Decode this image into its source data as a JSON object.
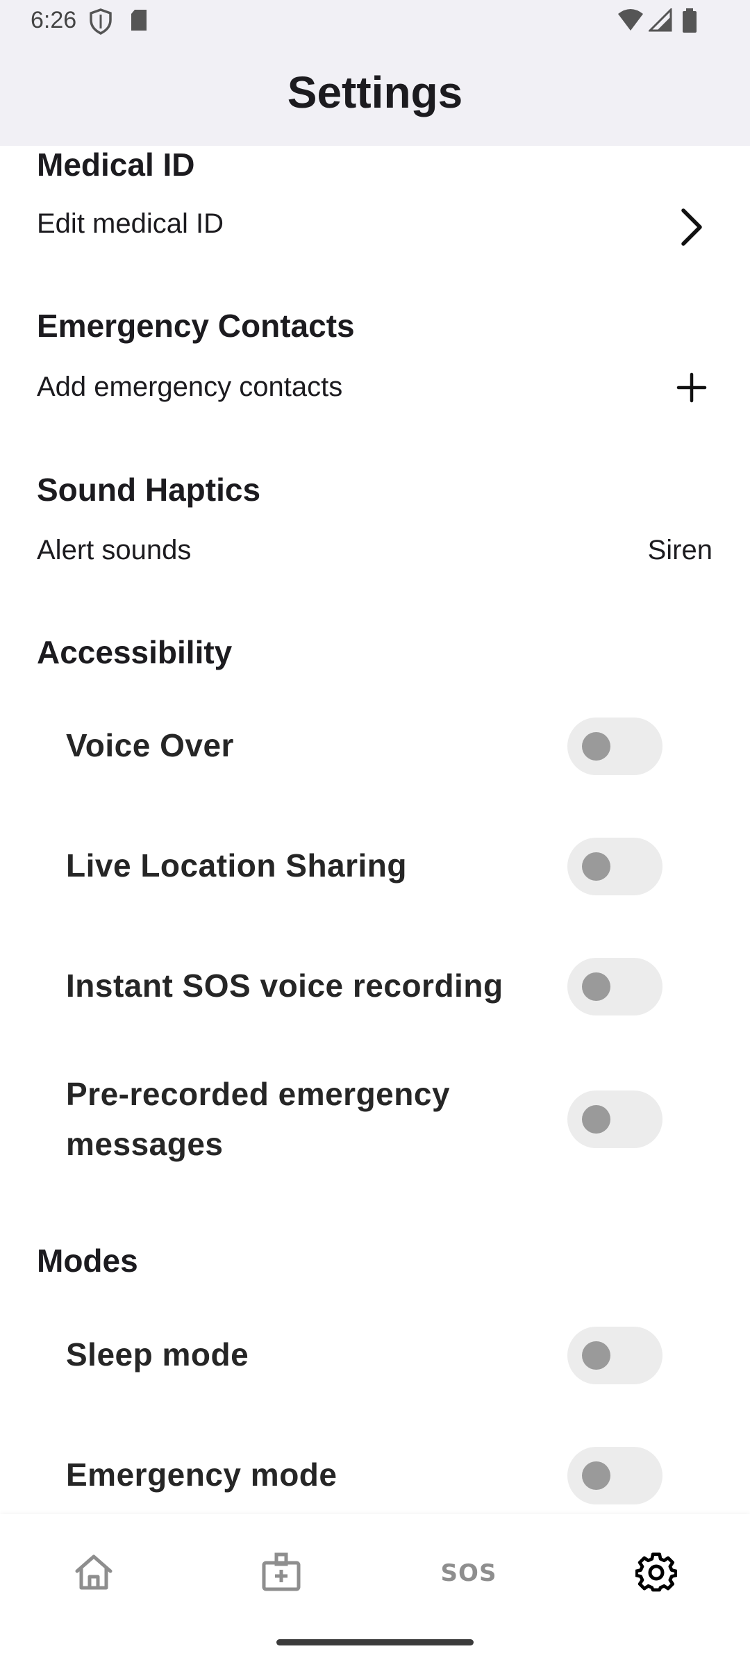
{
  "status_bar": {
    "time": "6:26",
    "icons": [
      "shield-icon",
      "sd-card-icon",
      "wifi-icon",
      "signal-icon",
      "battery-icon"
    ]
  },
  "app_bar": {
    "title": "Settings"
  },
  "sections": {
    "medical_id": {
      "title": "Medical ID",
      "row_label": "Edit medical ID",
      "icon": "chevron-right-icon"
    },
    "emergency_contacts": {
      "title": "Emergency Contacts",
      "row_label": "Add emergency contacts",
      "icon": "plus-icon"
    },
    "sound_haptics": {
      "title": "Sound Haptics",
      "row_label": "Alert sounds",
      "row_value": "Siren"
    },
    "accessibility": {
      "title": "Accessibility",
      "toggles": [
        {
          "label": "Voice Over",
          "on": false
        },
        {
          "label": "Live Location Sharing",
          "on": false
        },
        {
          "label": "Instant SOS voice recording",
          "on": false
        },
        {
          "label_line1": "Pre-recorded emergency",
          "label_line2": "messages",
          "on": false
        }
      ]
    },
    "modes": {
      "title": "Modes",
      "toggles": [
        {
          "label": "Sleep mode",
          "on": false
        },
        {
          "label": "Emergency mode",
          "on": false
        }
      ]
    }
  },
  "bottom_nav": {
    "items": [
      {
        "icon": "home-icon",
        "active": false
      },
      {
        "icon": "medical-id-icon",
        "active": false
      },
      {
        "label": "SOS",
        "active": false
      },
      {
        "icon": "gear-icon",
        "active": true
      }
    ]
  },
  "colors": {
    "app_bar_bg": "#f1f0f5",
    "toggle_track_off": "#ececec",
    "toggle_knob_off": "#9a9a9a",
    "nav_inactive": "#8e8e8e",
    "nav_active": "#000000"
  }
}
